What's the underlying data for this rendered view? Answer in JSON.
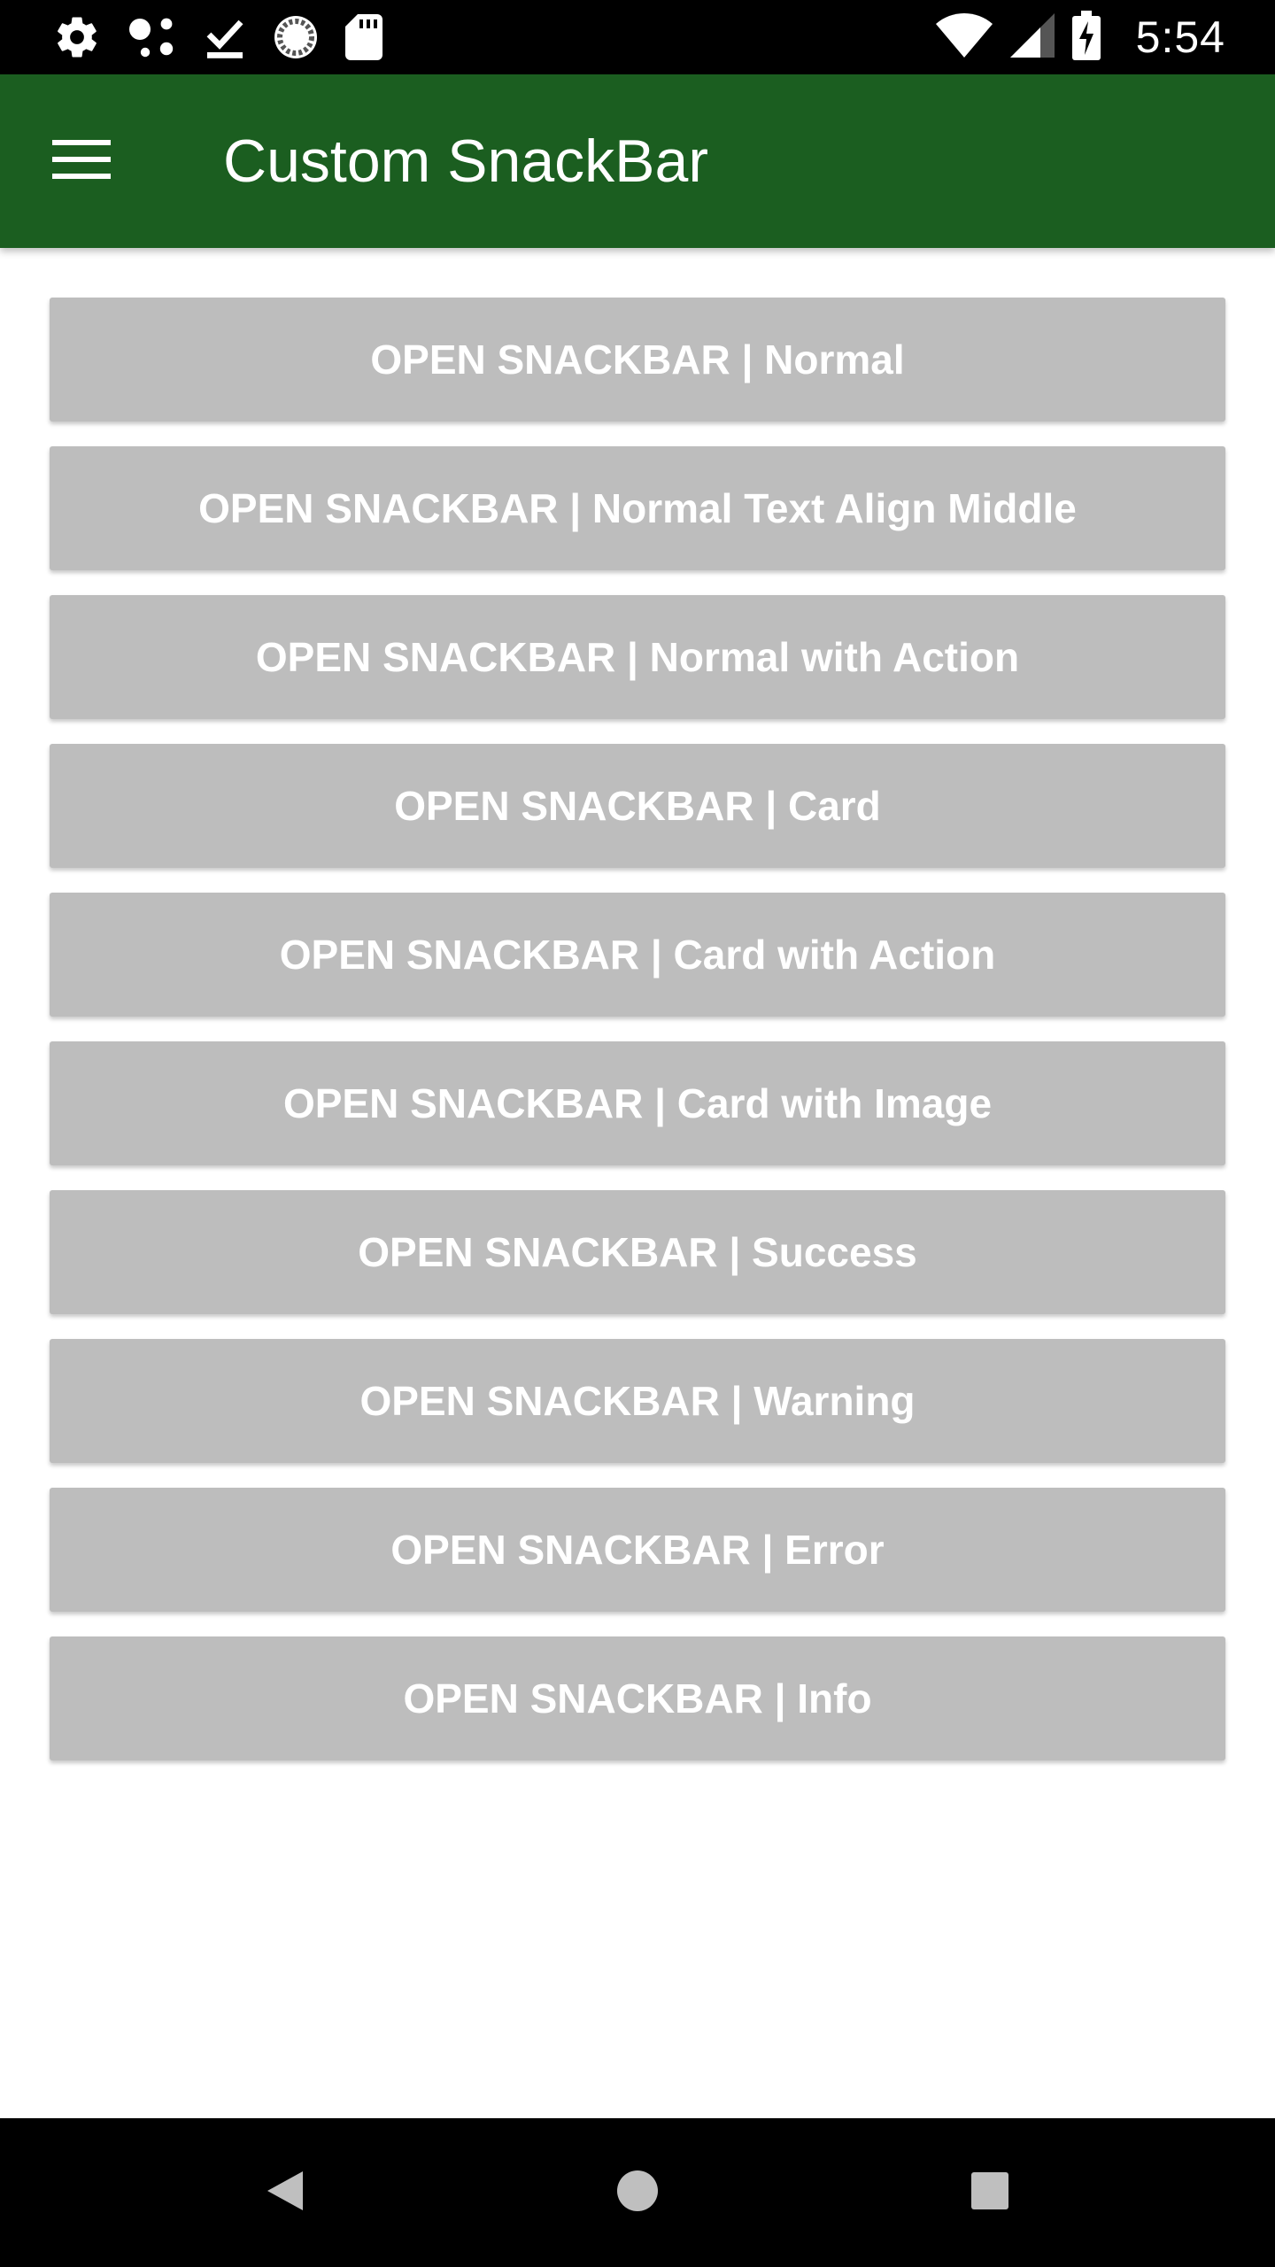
{
  "status_bar": {
    "icons_left": [
      "gear-icon",
      "connection-dots-icon",
      "download-done-icon",
      "sync-circle-icon",
      "sd-card-icon"
    ],
    "icons_right": [
      "wifi-icon",
      "signal-icon",
      "battery-charging-icon"
    ],
    "time": "5:54"
  },
  "app_bar": {
    "title": "Custom SnackBar",
    "background_color": "#1b5e20",
    "menu_icon": "hamburger-menu-icon"
  },
  "buttons": [
    {
      "label": "OPEN SNACKBAR | Normal"
    },
    {
      "label": "OPEN SNACKBAR | Normal Text Align Middle"
    },
    {
      "label": "OPEN SNACKBAR | Normal with Action"
    },
    {
      "label": "OPEN SNACKBAR | Card"
    },
    {
      "label": "OPEN SNACKBAR | Card with Action"
    },
    {
      "label": "OPEN SNACKBAR | Card with Image"
    },
    {
      "label": "OPEN SNACKBAR | Success"
    },
    {
      "label": "OPEN SNACKBAR | Warning"
    },
    {
      "label": "OPEN SNACKBAR | Error"
    },
    {
      "label": "OPEN SNACKBAR | Info"
    }
  ],
  "button_style": {
    "background_color": "#bdbdbd",
    "text_color": "#ffffff"
  },
  "nav_bar": {
    "icons": [
      "back-icon",
      "home-icon",
      "recents-icon"
    ]
  }
}
